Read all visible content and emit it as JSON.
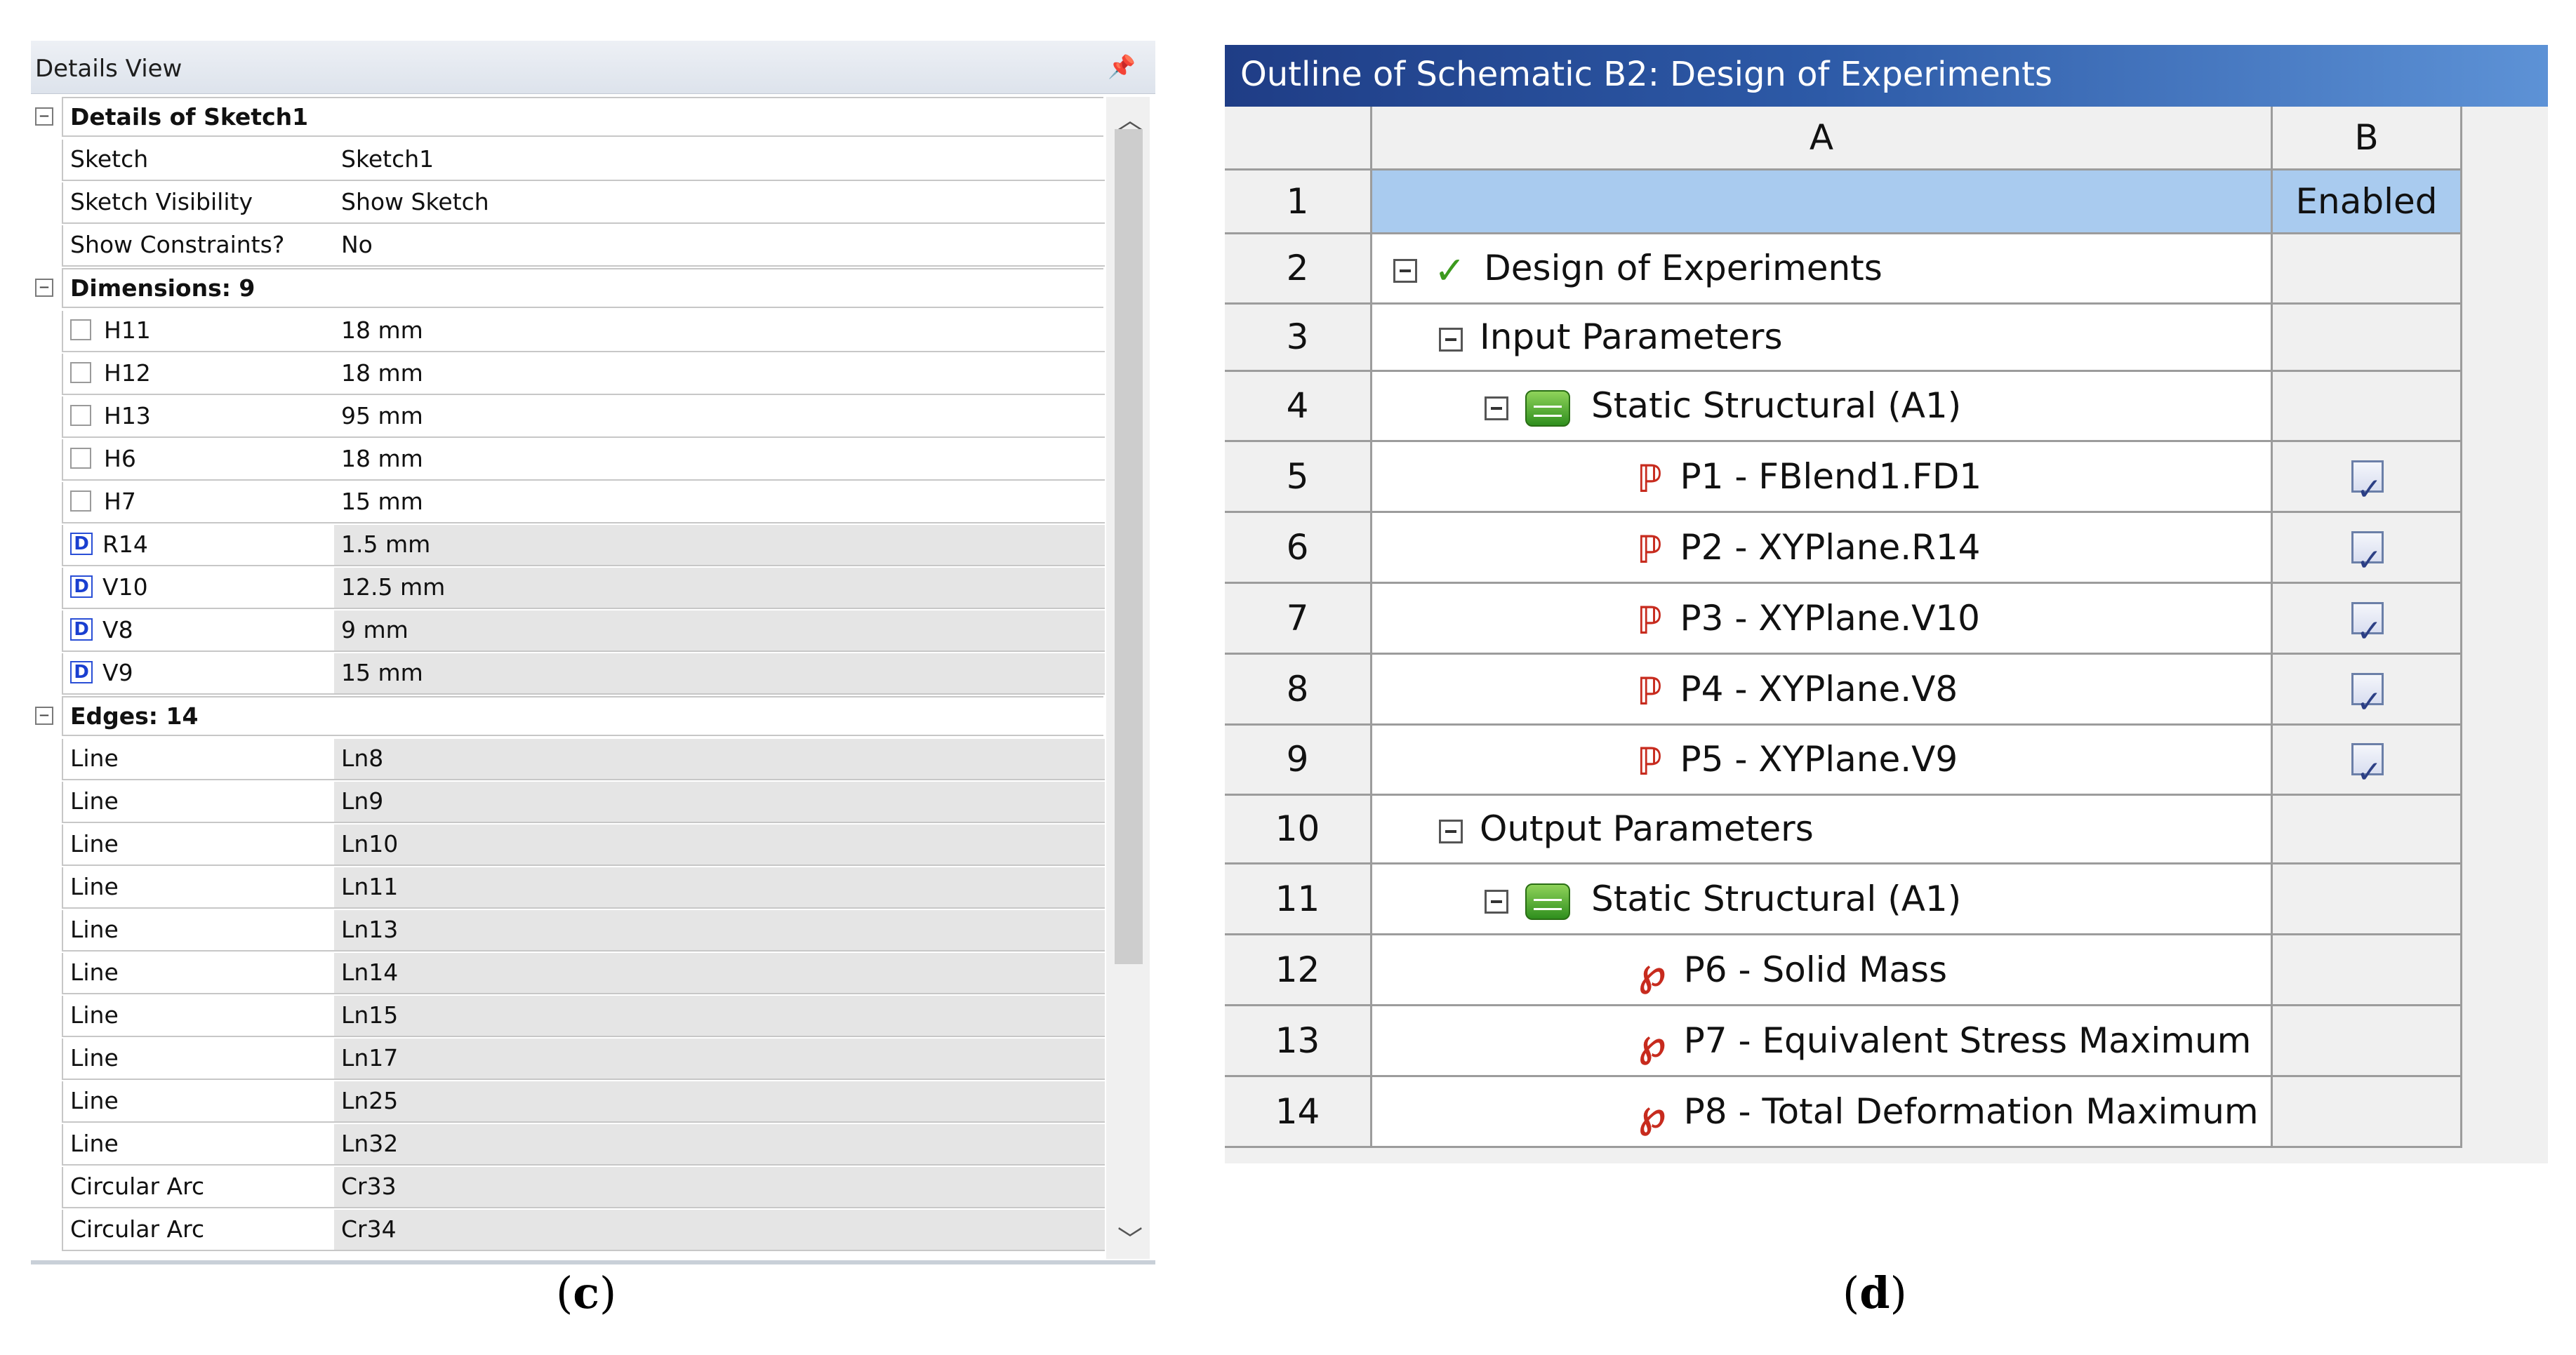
{
  "details_view": {
    "title": "Details View",
    "pin_icon": "pin-icon",
    "rows": [
      {
        "kind": "group",
        "label": "Details of Sketch1"
      },
      {
        "kind": "row",
        "label": "Sketch",
        "value": "Sketch1",
        "gray": false,
        "marker": "none"
      },
      {
        "kind": "row",
        "label": "Sketch Visibility",
        "value": "Show Sketch",
        "gray": false,
        "marker": "none"
      },
      {
        "kind": "row",
        "label": "Show Constraints?",
        "value": "No",
        "gray": false,
        "marker": "none"
      },
      {
        "kind": "group",
        "label": "Dimensions: 9"
      },
      {
        "kind": "row",
        "label": "H11",
        "value": "18 mm",
        "gray": false,
        "marker": "checkbox"
      },
      {
        "kind": "row",
        "label": "H12",
        "value": "18 mm",
        "gray": false,
        "marker": "checkbox"
      },
      {
        "kind": "row",
        "label": "H13",
        "value": "95 mm",
        "gray": false,
        "marker": "checkbox"
      },
      {
        "kind": "row",
        "label": "H6",
        "value": "18 mm",
        "gray": false,
        "marker": "checkbox"
      },
      {
        "kind": "row",
        "label": "H7",
        "value": "15 mm",
        "gray": false,
        "marker": "checkbox"
      },
      {
        "kind": "row",
        "label": "R14",
        "value": "1.5 mm",
        "gray": true,
        "marker": "D"
      },
      {
        "kind": "row",
        "label": "V10",
        "value": "12.5 mm",
        "gray": true,
        "marker": "D"
      },
      {
        "kind": "row",
        "label": "V8",
        "value": "9 mm",
        "gray": true,
        "marker": "D"
      },
      {
        "kind": "row",
        "label": "V9",
        "value": "15 mm",
        "gray": true,
        "marker": "D"
      },
      {
        "kind": "group",
        "label": "Edges: 14"
      },
      {
        "kind": "row",
        "label": "Line",
        "value": "Ln8",
        "gray": true,
        "marker": "none"
      },
      {
        "kind": "row",
        "label": "Line",
        "value": "Ln9",
        "gray": true,
        "marker": "none"
      },
      {
        "kind": "row",
        "label": "Line",
        "value": "Ln10",
        "gray": true,
        "marker": "none"
      },
      {
        "kind": "row",
        "label": "Line",
        "value": "Ln11",
        "gray": true,
        "marker": "none"
      },
      {
        "kind": "row",
        "label": "Line",
        "value": "Ln13",
        "gray": true,
        "marker": "none"
      },
      {
        "kind": "row",
        "label": "Line",
        "value": "Ln14",
        "gray": true,
        "marker": "none"
      },
      {
        "kind": "row",
        "label": "Line",
        "value": "Ln15",
        "gray": true,
        "marker": "none"
      },
      {
        "kind": "row",
        "label": "Line",
        "value": "Ln17",
        "gray": true,
        "marker": "none"
      },
      {
        "kind": "row",
        "label": "Line",
        "value": "Ln25",
        "gray": true,
        "marker": "none"
      },
      {
        "kind": "row",
        "label": "Line",
        "value": "Ln32",
        "gray": true,
        "marker": "none"
      },
      {
        "kind": "row",
        "label": "Circular Arc",
        "value": "Cr33",
        "gray": true,
        "marker": "none"
      },
      {
        "kind": "row",
        "label": "Circular Arc",
        "value": "Cr34",
        "gray": true,
        "marker": "none"
      }
    ],
    "caption_open": "(",
    "caption_letter": "c",
    "caption_close": ")"
  },
  "outline": {
    "title": "Outline of Schematic B2: Design of Experiments",
    "col_a": "A",
    "col_b": "B",
    "rows": [
      {
        "num": "1",
        "text": "",
        "icon": "none",
        "b": "Enabled",
        "checked": false
      },
      {
        "num": "2",
        "text": "Design of Experiments",
        "icon": "check-icon",
        "b": "",
        "checked": false
      },
      {
        "num": "3",
        "text": "Input Parameters",
        "icon": "none",
        "b": "",
        "checked": false
      },
      {
        "num": "4",
        "text": "Static Structural (A1)",
        "icon": "static-structural-icon",
        "b": "",
        "checked": false
      },
      {
        "num": "5",
        "text": "P1 - FBlend1.FD1",
        "icon": "input-parameter-icon",
        "b": "",
        "checked": true
      },
      {
        "num": "6",
        "text": "P2 - XYPlane.R14",
        "icon": "input-parameter-icon",
        "b": "",
        "checked": true
      },
      {
        "num": "7",
        "text": "P3 - XYPlane.V10",
        "icon": "input-parameter-icon",
        "b": "",
        "checked": true
      },
      {
        "num": "8",
        "text": "P4 - XYPlane.V8",
        "icon": "input-parameter-icon",
        "b": "",
        "checked": true
      },
      {
        "num": "9",
        "text": "P5 - XYPlane.V9",
        "icon": "input-parameter-icon",
        "b": "",
        "checked": true
      },
      {
        "num": "10",
        "text": "Output Parameters",
        "icon": "none",
        "b": "",
        "checked": false
      },
      {
        "num": "11",
        "text": "Static Structural (A1)",
        "icon": "static-structural-icon",
        "b": "",
        "checked": false
      },
      {
        "num": "12",
        "text": "P6 - Solid Mass",
        "icon": "output-parameter-icon",
        "b": "",
        "checked": false
      },
      {
        "num": "13",
        "text": "P7 - Equivalent Stress Maximum",
        "icon": "output-parameter-icon",
        "b": "",
        "checked": false
      },
      {
        "num": "14",
        "text": "P8 - Total Deformation Maximum",
        "icon": "output-parameter-icon",
        "b": "",
        "checked": false
      }
    ],
    "caption_open": "(",
    "caption_letter": "d",
    "caption_close": ")"
  },
  "colors": {
    "highlight": "#a9cbef",
    "title_bar": "#2d5aa7",
    "gray_cell": "#e5e5e5"
  }
}
